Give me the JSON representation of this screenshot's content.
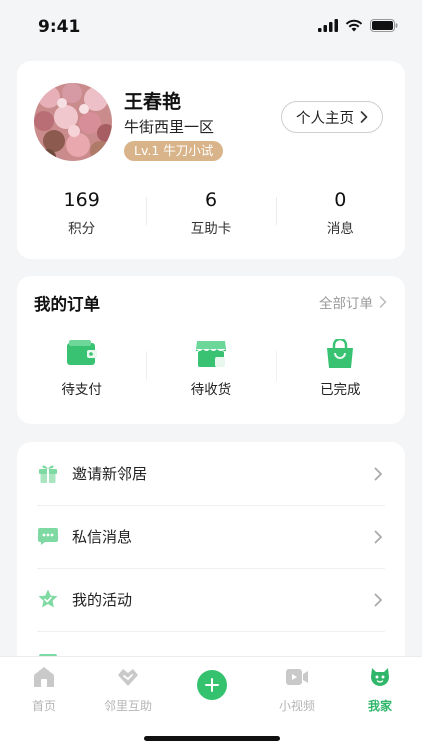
{
  "status_bar": {
    "time": "9:41"
  },
  "profile": {
    "name": "王春艳",
    "location": "牛街西里一区",
    "level_badge": "Lv.1 牛刀小试",
    "homepage_button": "个人主页",
    "stats": [
      {
        "value": "169",
        "label": "积分"
      },
      {
        "value": "6",
        "label": "互助卡"
      },
      {
        "value": "0",
        "label": "消息"
      }
    ]
  },
  "orders": {
    "title": "我的订单",
    "all_link": "全部订单",
    "items": [
      {
        "label": "待支付",
        "icon": "wallet-icon"
      },
      {
        "label": "待收货",
        "icon": "store-icon"
      },
      {
        "label": "已完成",
        "icon": "bag-icon"
      }
    ]
  },
  "menu": {
    "items": [
      {
        "label": "邀请新邻居",
        "icon": "gift-icon"
      },
      {
        "label": "私信消息",
        "icon": "chat-icon"
      },
      {
        "label": "我的活动",
        "icon": "star-icon"
      }
    ]
  },
  "tab_bar": {
    "tabs": [
      {
        "label": "首页",
        "icon": "home-icon"
      },
      {
        "label": "邻里互助",
        "icon": "handshake-icon"
      },
      {
        "label": "",
        "icon": "add-icon"
      },
      {
        "label": "小视频",
        "icon": "video-icon"
      },
      {
        "label": "我家",
        "icon": "me-icon",
        "active": true
      }
    ]
  },
  "colors": {
    "accent": "#35c26f",
    "badge": "#d9b48a",
    "background": "#f4f5f6"
  }
}
